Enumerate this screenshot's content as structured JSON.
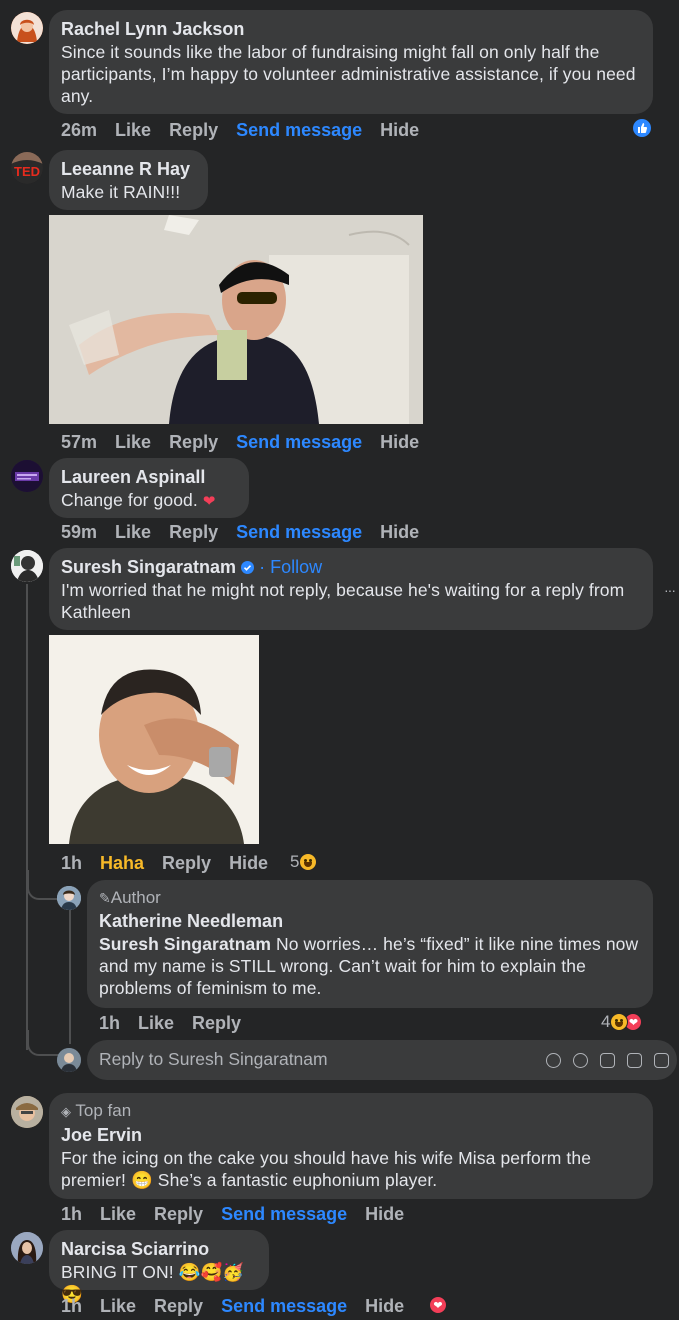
{
  "comments": [
    {
      "name": "Rachel Lynn Jackson",
      "text": "Since it sounds like the labor of fundraising might fall on only half the participants, I’m happy to volunteer administrative assistance, if you need any.",
      "time": "26m",
      "like": "Like",
      "reply": "Reply",
      "send": "Send message",
      "hide": "Hide"
    },
    {
      "name": "Leeanne R Hay",
      "text": "Make it RAIN!!!",
      "time": "57m",
      "like": "Like",
      "reply": "Reply",
      "send": "Send message",
      "hide": "Hide",
      "avatar_text": "TED"
    },
    {
      "name": "Laureen Aspinall",
      "text": "Change for good.",
      "time": "59m",
      "like": "Like",
      "reply": "Reply",
      "send": "Send message",
      "hide": "Hide"
    },
    {
      "name": "Suresh Singaratnam",
      "follow": "· Follow",
      "text": "I'm worried that he might not reply, because he's waiting for a reply from Kathleen",
      "time": "1h",
      "reaction_label": "Haha",
      "reply": "Reply",
      "hide": "Hide",
      "react_count": "5",
      "more": "···"
    },
    {
      "name": "Joe Ervin",
      "badge": "Top fan",
      "text": "For the icing on the cake you should have his wife Misa perform the premier! 😁 She’s a fantastic euphonium player.",
      "time": "1h",
      "like": "Like",
      "reply": "Reply",
      "send": "Send message",
      "hide": "Hide"
    },
    {
      "name": "Narcisa Sciarrino",
      "text": "BRING IT ON! 😂🥰🥳😎",
      "time": "1h",
      "like": "Like",
      "reply": "Reply",
      "send": "Send message",
      "hide": "Hide"
    }
  ],
  "reply": {
    "badge": "Author",
    "name": "Katherine Needleman",
    "mention": "Suresh Singaratnam",
    "text": " No worries… he’s “fixed” it like nine times now and my name is STILL wrong. Can’t wait for him to explain the problems of feminism to me.",
    "time": "1h",
    "like": "Like",
    "reply": "Reply",
    "react_count": "4"
  },
  "reply_box": {
    "placeholder": "Reply to Suresh Singaratnam"
  },
  "colors": {
    "background": "#242526",
    "bubble": "#3a3b3c",
    "link": "#2d88ff",
    "haha": "#f7b928",
    "muted": "#b0b3b8"
  }
}
